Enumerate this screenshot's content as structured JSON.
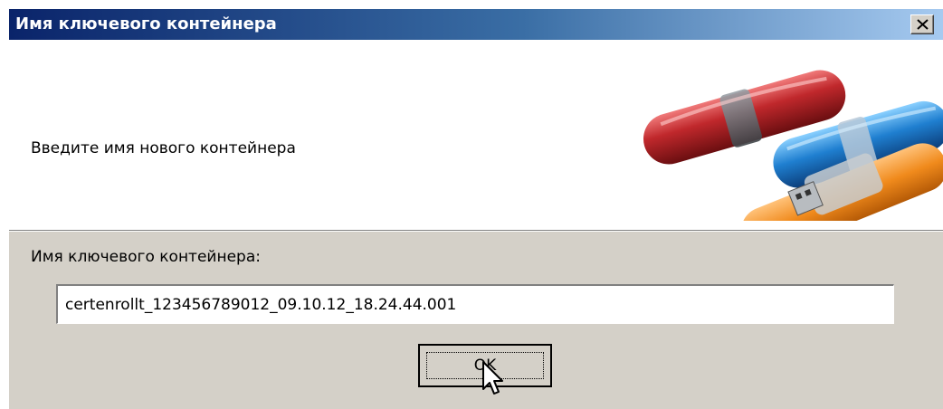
{
  "window": {
    "title": "Имя ключевого контейнера"
  },
  "banner": {
    "prompt": "Введите имя нового контейнера"
  },
  "form": {
    "label": "Имя ключевого контейнера:",
    "container_name": "certenrollt_123456789012_09.10.12_18.24.44.001"
  },
  "buttons": {
    "ok_label": "OK"
  },
  "icons": {
    "close": "close-icon",
    "banner_art": "usb-token-icon",
    "cursor": "mouse-cursor-icon"
  },
  "colors": {
    "title_start": "#0a246a",
    "title_end": "#a6caf0",
    "dialog_bg": "#d4d0c8",
    "token_red": "#c0282c",
    "token_blue": "#1f7fd0",
    "token_orange": "#f08a1c"
  }
}
